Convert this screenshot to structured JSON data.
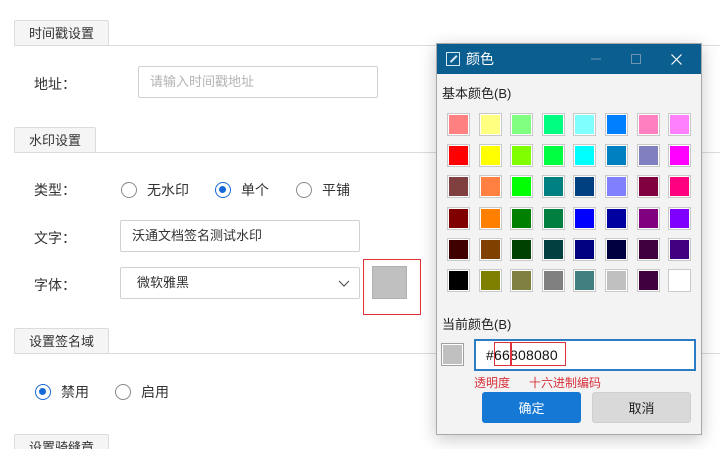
{
  "sections": {
    "timestamp": {
      "title": "时间戳设置",
      "address_label": "地址：",
      "address_placeholder": "请输入时间戳地址"
    },
    "watermark": {
      "title": "水印设置",
      "type_label": "类型：",
      "type_options": [
        "无水印",
        "单个",
        "平铺"
      ],
      "type_selected": "单个",
      "text_label": "文字：",
      "text_value": "沃通文档签名测试水印",
      "font_label": "字体：",
      "font_value": "微软雅黑",
      "color_swatch": "#c0c0c0"
    },
    "signature_field": {
      "title": "设置签名域",
      "options": [
        "禁用",
        "启用"
      ],
      "selected": "禁用"
    },
    "seam_seal": {
      "title": "设置骑缝章"
    }
  },
  "color_dialog": {
    "title": "颜色",
    "basic_colors_label": "基本颜色(B)",
    "basic_colors": [
      [
        "#ff8080",
        "#ffff80",
        "#80ff80",
        "#00ff80",
        "#80ffff",
        "#0080ff",
        "#ff80c0",
        "#ff80ff"
      ],
      [
        "#ff0000",
        "#ffff00",
        "#80ff00",
        "#00ff40",
        "#00ffff",
        "#0080c0",
        "#8080c0",
        "#ff00ff"
      ],
      [
        "#804040",
        "#ff8040",
        "#00ff00",
        "#008080",
        "#004080",
        "#8080ff",
        "#800040",
        "#ff0080"
      ],
      [
        "#800000",
        "#ff8000",
        "#008000",
        "#008040",
        "#0000ff",
        "#0000a0",
        "#800080",
        "#8000ff"
      ],
      [
        "#400000",
        "#804000",
        "#004000",
        "#004040",
        "#000080",
        "#000040",
        "#400040",
        "#400080"
      ],
      [
        "#000000",
        "#808000",
        "#808040",
        "#808080",
        "#408080",
        "#c0c0c0",
        "#400040",
        "#ffffff"
      ]
    ],
    "current_color_label": "当前颜色(B)",
    "current_color": "#c0c0c0",
    "hex_prefix": "#",
    "hex_alpha": "66",
    "hex_rgb": "808080",
    "annotation_alpha": "透明度",
    "annotation_hex": "十六进制编码",
    "ok_label": "确定",
    "cancel_label": "取消"
  }
}
